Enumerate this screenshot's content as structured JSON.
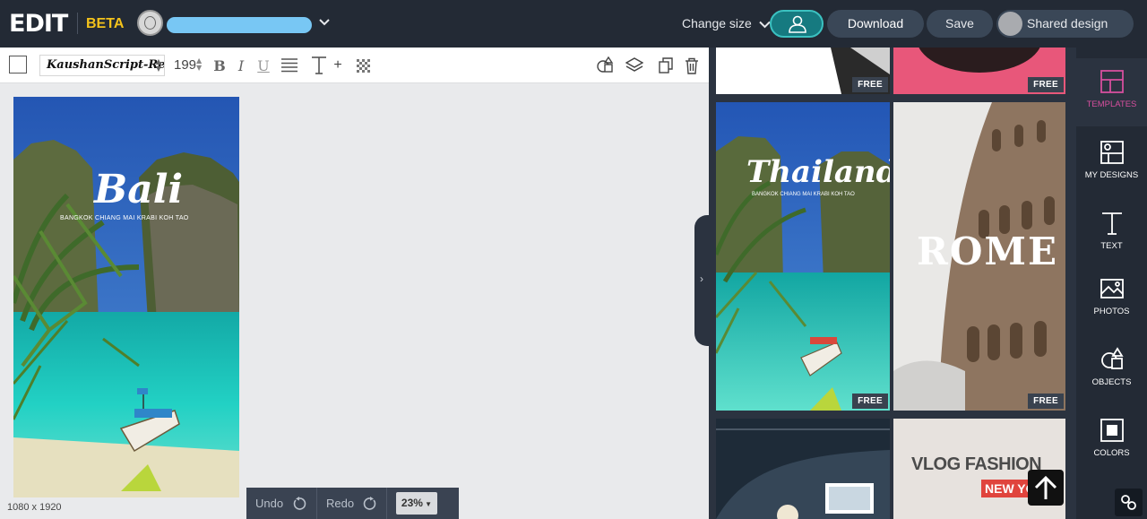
{
  "app": {
    "logo_text": "EDIT",
    "beta_label": "BETA"
  },
  "header": {
    "change_size_label": "Change size",
    "download_label": "Download",
    "save_label": "Save",
    "shared_label": "Shared design"
  },
  "toolbar": {
    "font_name": "KaushanScript-Regular",
    "font_size": "199",
    "bold_label": "B",
    "italic_label": "I",
    "underline_label": "U",
    "text_plus_label": "+"
  },
  "canvas": {
    "design_title": "Bali",
    "design_subtitle": "BANGKOK  CHIANG MAI  KRABI  KOH TAO",
    "dimensions_label": "1080 x 1920"
  },
  "history": {
    "undo_label": "Undo",
    "redo_label": "Redo",
    "zoom_label": "23%"
  },
  "templates": {
    "free_label": "FREE",
    "thailand_title": "Thailand",
    "thailand_subtitle": "BANGKOK  CHIANG MAI  KRABI  KOH TAO",
    "rome_title": "ROME",
    "vlog_title": "VLOG FASHION",
    "vlog_sub": "NEW YO"
  },
  "sidenav": {
    "items": [
      {
        "label": "TEMPLATES",
        "icon": "templates-icon"
      },
      {
        "label": "MY DESIGNS",
        "icon": "my-designs-icon"
      },
      {
        "label": "TEXT",
        "icon": "text-icon"
      },
      {
        "label": "PHOTOS",
        "icon": "photos-icon"
      },
      {
        "label": "OBJECTS",
        "icon": "objects-icon"
      },
      {
        "label": "COLORS",
        "icon": "colors-icon"
      }
    ]
  },
  "colors": {
    "topbar_bg": "#232a35",
    "panel_bg": "#2b3340",
    "beta_yellow": "#f3c21b",
    "share_teal": "#3bc1c0",
    "active_pink": "#d64f9e"
  }
}
